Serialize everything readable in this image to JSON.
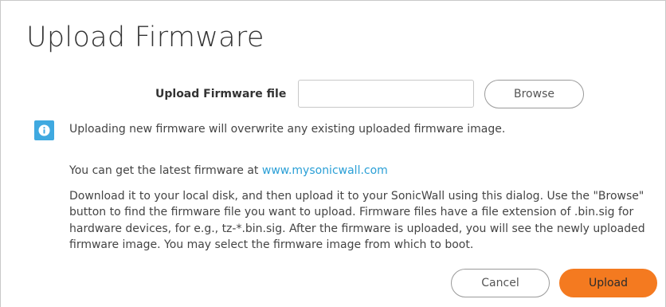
{
  "dialog": {
    "title": "Upload Firmware"
  },
  "upload_field": {
    "label": "Upload Firmware file",
    "value": "",
    "placeholder": ""
  },
  "buttons": {
    "browse": "Browse",
    "cancel": "Cancel",
    "upload": "Upload"
  },
  "info": {
    "icon": "info-icon",
    "text": "Uploading new firmware will overwrite any existing uploaded firmware image."
  },
  "latest": {
    "prefix": "You can get the latest firmware at ",
    "link_text": "www.mysonicwall.com"
  },
  "description": "Download it to your local disk, and then upload it to your SonicWall using this dialog. Use the \"Browse\" button to find the firmware file you want to upload. Firmware files have a file extension of .bin.sig for hardware devices, for e.g., tz-*.bin.sig. After the firmware is uploaded, you will see the newly uploaded firmware image. You may select the firmware image from which to boot.",
  "colors": {
    "accent": "#f47a20",
    "link": "#2a9fd6",
    "info": "#3fa9e0"
  }
}
